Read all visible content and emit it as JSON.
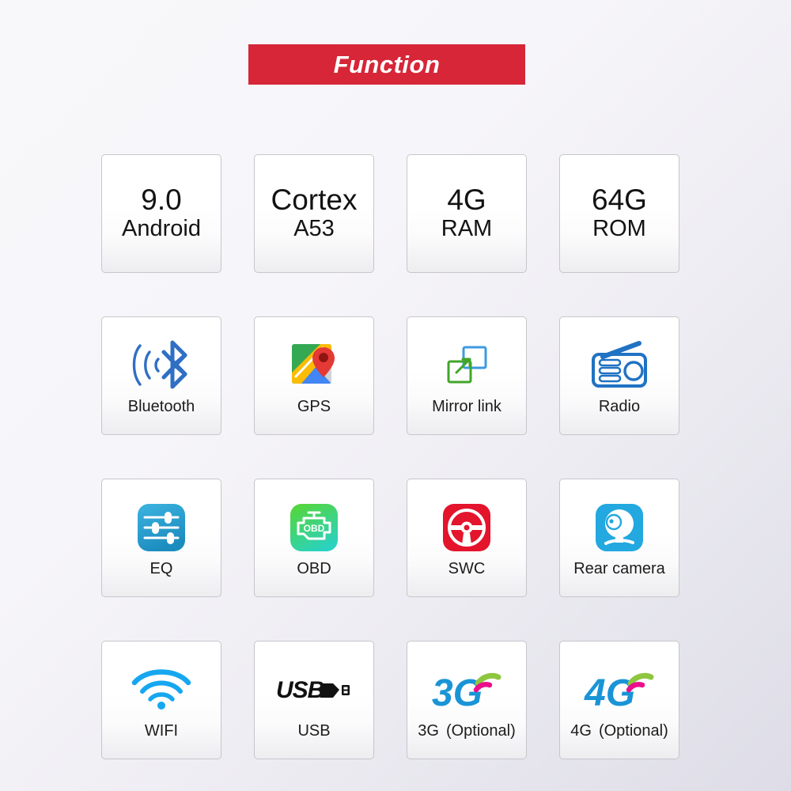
{
  "banner": {
    "title": "Function",
    "bg_color": "#d62638",
    "text_color": "#ffffff"
  },
  "page": {
    "background_from": "#f8f8fb",
    "background_to": "#dedde7"
  },
  "grid": {
    "columns": 4,
    "rows": 4,
    "cells": [
      {
        "type": "text",
        "big": "9.0",
        "sub": "Android",
        "name": "android-version"
      },
      {
        "type": "text",
        "big": "Cortex",
        "sub": "A53",
        "name": "cpu"
      },
      {
        "type": "text",
        "big": "4G",
        "sub": "RAM",
        "name": "ram"
      },
      {
        "type": "text",
        "big": "64G",
        "sub": "ROM",
        "name": "rom"
      },
      {
        "type": "icon",
        "icon": "bluetooth-icon",
        "label": "Bluetooth",
        "name": "bluetooth",
        "color": "#2f6fc4"
      },
      {
        "type": "icon",
        "icon": "gps-map-icon",
        "label": "GPS",
        "name": "gps",
        "color": "#34a853"
      },
      {
        "type": "icon",
        "icon": "mirror-link-icon",
        "label": "Mirror link",
        "name": "mirror-link",
        "color": "#41a62a"
      },
      {
        "type": "icon",
        "icon": "radio-icon",
        "label": "Radio",
        "name": "radio",
        "color": "#2072c3"
      },
      {
        "type": "icon",
        "icon": "equalizer-icon",
        "label": "EQ",
        "name": "eq",
        "color": "#27a3d4"
      },
      {
        "type": "icon",
        "icon": "obd-engine-icon",
        "label": "OBD",
        "name": "obd",
        "color": "#4ddb92"
      },
      {
        "type": "icon",
        "icon": "steering-wheel-icon",
        "label": "SWC",
        "name": "swc",
        "color": "#e3142c"
      },
      {
        "type": "icon",
        "icon": "rear-camera-icon",
        "label": "Rear camera",
        "name": "rear-camera",
        "color": "#23a8e0"
      },
      {
        "type": "icon",
        "icon": "wifi-icon",
        "label": "WIFI",
        "name": "wifi",
        "color": "#16a7f0"
      },
      {
        "type": "icon",
        "icon": "usb-icon",
        "label": "USB",
        "name": "usb",
        "color": "#111111"
      },
      {
        "type": "icon",
        "icon": "3g-signal-icon",
        "label": "3G",
        "label_note": "(Optional)",
        "name": "3g",
        "color": "#1a94d6"
      },
      {
        "type": "icon",
        "icon": "4g-signal-icon",
        "label": "4G",
        "label_note": "(Optional)",
        "name": "4g",
        "color": "#1a94d6"
      }
    ]
  }
}
